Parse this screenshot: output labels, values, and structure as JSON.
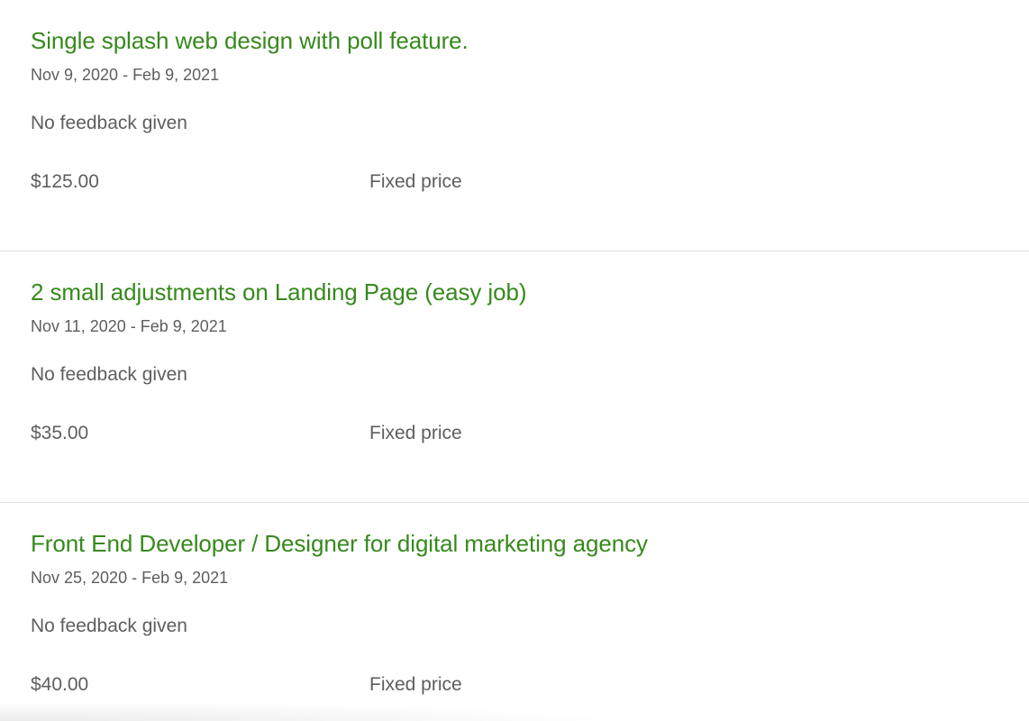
{
  "jobs": [
    {
      "title": "Single splash web design with poll feature.",
      "dates": "Nov 9, 2020 - Feb 9, 2021",
      "feedback": "No feedback given",
      "amount": "$125.00",
      "type": "Fixed price"
    },
    {
      "title": "2 small adjustments on Landing Page (easy job)",
      "dates": "Nov 11, 2020 - Feb 9, 2021",
      "feedback": "No feedback given",
      "amount": "$35.00",
      "type": "Fixed price"
    },
    {
      "title": "Front End Developer / Designer for digital marketing agency",
      "dates": "Nov 25, 2020 - Feb 9, 2021",
      "feedback": "No feedback given",
      "amount": "$40.00",
      "type": "Fixed price"
    }
  ],
  "colors": {
    "title_link": "#37891d",
    "text_muted": "#5e5e5e",
    "divider": "#e0e0e0"
  }
}
